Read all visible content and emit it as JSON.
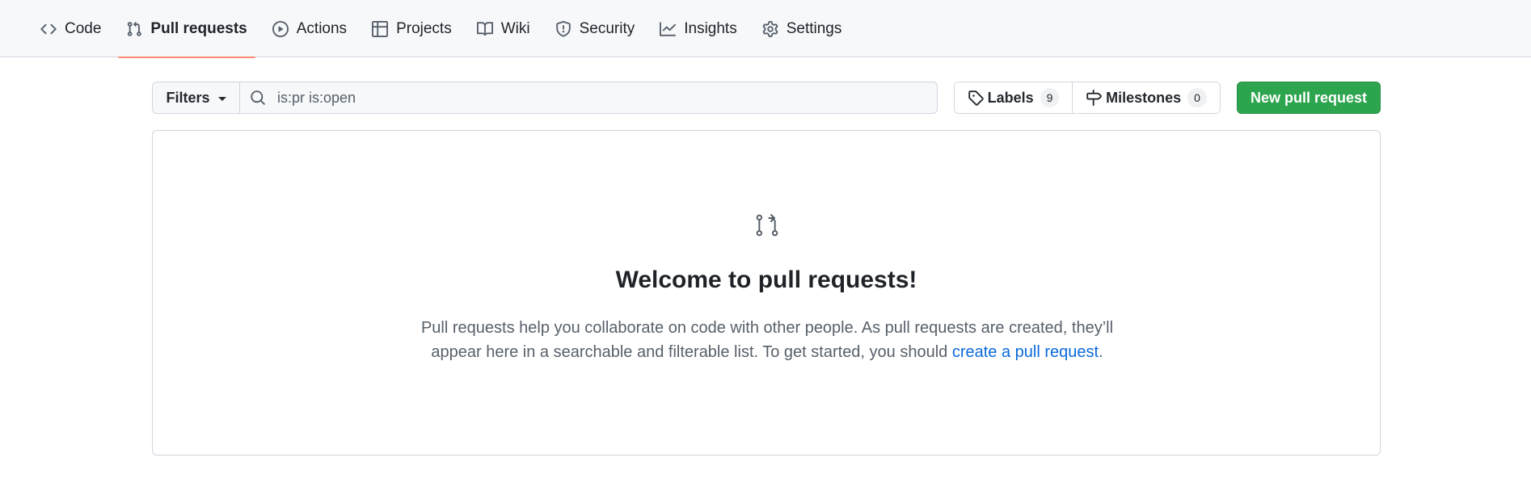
{
  "nav": {
    "items": [
      {
        "label": "Code",
        "icon": "code-icon"
      },
      {
        "label": "Pull requests",
        "icon": "git-pull-request-icon"
      },
      {
        "label": "Actions",
        "icon": "play-icon"
      },
      {
        "label": "Projects",
        "icon": "table-icon"
      },
      {
        "label": "Wiki",
        "icon": "book-icon"
      },
      {
        "label": "Security",
        "icon": "shield-icon"
      },
      {
        "label": "Insights",
        "icon": "graph-icon"
      },
      {
        "label": "Settings",
        "icon": "gear-icon"
      }
    ],
    "selected": "Pull requests",
    "selected_underline_color": "#fd8c73"
  },
  "toolbar": {
    "filters_label": "Filters",
    "search_value": "is:pr is:open",
    "labels_label": "Labels",
    "labels_count": "9",
    "milestones_label": "Milestones",
    "milestones_count": "0",
    "new_pr_label": "New pull request",
    "new_pr_color": "#2da44e"
  },
  "blankslate": {
    "icon": "git-pull-request-icon",
    "title": "Welcome to pull requests!",
    "desc_before": "Pull requests help you collaborate on code with other people. As pull requests are created, they’ll appear here in a searchable and filterable list. To get started, you should ",
    "link": "create a pull request",
    "desc_after": ".",
    "link_color": "#0969da"
  }
}
